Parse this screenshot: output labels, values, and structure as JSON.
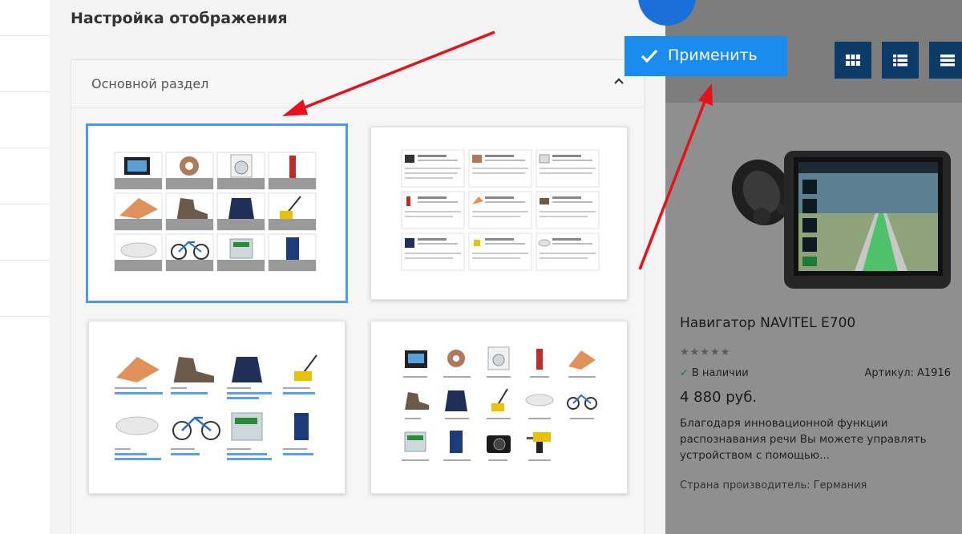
{
  "panel": {
    "title": "Настройка отображения",
    "section_label": "Основной раздел",
    "options": [
      {
        "id": "tiles",
        "selected": true
      },
      {
        "id": "cards-list",
        "selected": false
      },
      {
        "id": "blocks",
        "selected": false
      },
      {
        "id": "icons",
        "selected": false
      }
    ]
  },
  "apply_button": {
    "label": "Применить",
    "icon": "check-icon"
  },
  "view_switcher": {
    "icons": [
      "grid-view-icon",
      "list-view-icon",
      "table-view-icon"
    ]
  },
  "product": {
    "title": "Навигатор NAVITEL E700",
    "rating": "★★★★★",
    "stock": "В наличии",
    "sku": "Артикул: A1916",
    "price": "4 880 руб.",
    "description": "Благодаря инновационной функции распознавания речи Вы можете управлять устройством с помощью...",
    "country": "Страна производитель: Германия"
  },
  "colors": {
    "accent": "#1a8cf0",
    "selected_border": "#4a9bef",
    "view_buttons": "#0c3b68",
    "arrows": "#e8111b",
    "stock_check": "#1b7a2e"
  }
}
